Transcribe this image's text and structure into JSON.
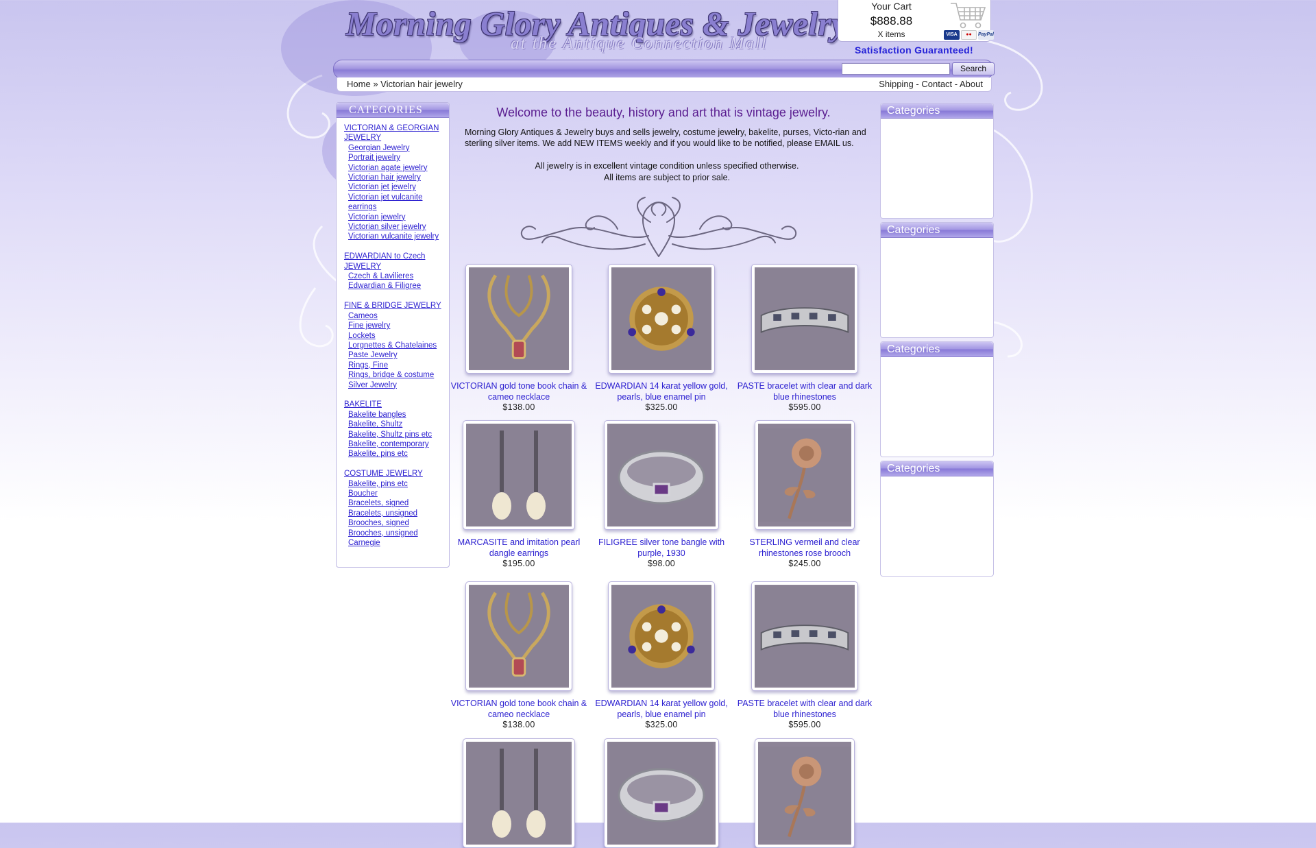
{
  "header": {
    "title": "Morning Glory Antiques & Jewelry",
    "subtitle": "at the Antique Connection Mall"
  },
  "cart": {
    "label": "Your Cart",
    "total": "$888.88",
    "items": "X items",
    "payment_icons": [
      "visa-card",
      "mastercard",
      "paypal"
    ]
  },
  "guarantee": "Satisfaction Guaranteed!",
  "search": {
    "button": "Search",
    "value": ""
  },
  "breadcrumb": {
    "home": "Home",
    "separator": "»",
    "current": "Victorian hair jewelry"
  },
  "top_links": [
    "Shipping",
    "Contact",
    "About"
  ],
  "left_sidebar": {
    "title": "CATEGORIES",
    "groups": [
      {
        "heading": "VICTORIAN & GEORGIAN JEWELRY",
        "items": [
          "Georgian Jewelry",
          "Portrait jewelry",
          "Victorian agate jewelry",
          "Victorian hair jewelry",
          "Victorian jet jewelry",
          "Victorian jet vulcanite earrings",
          "Victorian jewelry",
          "Victorian silver jewelry",
          "Victorian vulcanite jewelry"
        ]
      },
      {
        "heading": "EDWARDIAN to Czech JEWELRY",
        "items": [
          "Czech & Lavilieres",
          "Edwardian & Filigree"
        ]
      },
      {
        "heading": "FINE & BRIDGE JEWELRY",
        "items": [
          "Cameos",
          "Fine jewelry",
          "Lockets",
          "Lorgnettes & Chatelaines",
          "Paste Jewelry",
          "Rings, Fine",
          "Rings, bridge & costume",
          "Silver Jewelry"
        ]
      },
      {
        "heading": "BAKELITE",
        "items": [
          "Bakelite bangles",
          "Bakelite, Shultz",
          "Bakelite, Shultz pins etc",
          "Bakelite, contemporary",
          "Bakelite, pins etc"
        ]
      },
      {
        "heading": "COSTUME JEWELRY",
        "items": [
          "Bakelite, pins etc",
          "Boucher",
          "Bracelets, signed",
          "Bracelets, unsigned",
          "Brooches, signed",
          "Brooches, unsigned",
          "Carnegie"
        ]
      }
    ]
  },
  "right_sidebar": {
    "boxes": [
      "Categories",
      "Categories",
      "Categories",
      "Categories"
    ]
  },
  "main": {
    "welcome": "Welcome to the beauty, history and art that is vintage jewelry.",
    "intro": "Morning Glory Antiques & Jewelry buys and sells jewelry, costume jewelry, bakelite, purses, Victo-rian and sterling silver items. We add NEW ITEMS weekly and if you would like to be notified, please EMAIL us.",
    "condition": "All jewelry is in excellent vintage condition unless specified otherwise.",
    "sale_note": "All items are subject to prior sale."
  },
  "products": [
    {
      "name": "VICTORIAN gold tone book chain & cameo necklace",
      "price": "$138.00",
      "image": "necklace"
    },
    {
      "name": "EDWARDIAN 14 karat yellow gold, pearls, blue enamel pin",
      "price": "$325.00",
      "image": "brooch"
    },
    {
      "name": "PASTE bracelet with clear and dark blue rhinestones",
      "price": "$595.00",
      "image": "bracelet"
    },
    {
      "name": "MARCASITE and imitation pearl dangle earrings",
      "price": "$195.00",
      "image": "earrings"
    },
    {
      "name": "FILIGREE silver tone bangle with purple, 1930",
      "price": "$98.00",
      "image": "bangle"
    },
    {
      "name": "STERLING vermeil and clear rhinestones rose brooch",
      "price": "$245.00",
      "image": "rose"
    },
    {
      "name": "VICTORIAN gold tone book chain & cameo necklace",
      "price": "$138.00",
      "image": "necklace"
    },
    {
      "name": "EDWARDIAN 14 karat yellow gold, pearls, blue enamel pin",
      "price": "$325.00",
      "image": "brooch"
    },
    {
      "name": "PASTE bracelet with clear and dark blue rhinestones",
      "price": "$595.00",
      "image": "bracelet"
    },
    {
      "name": "",
      "price": "",
      "image": "earrings"
    },
    {
      "name": "",
      "price": "",
      "image": "bangle"
    },
    {
      "name": "",
      "price": "",
      "image": "rose"
    }
  ]
}
